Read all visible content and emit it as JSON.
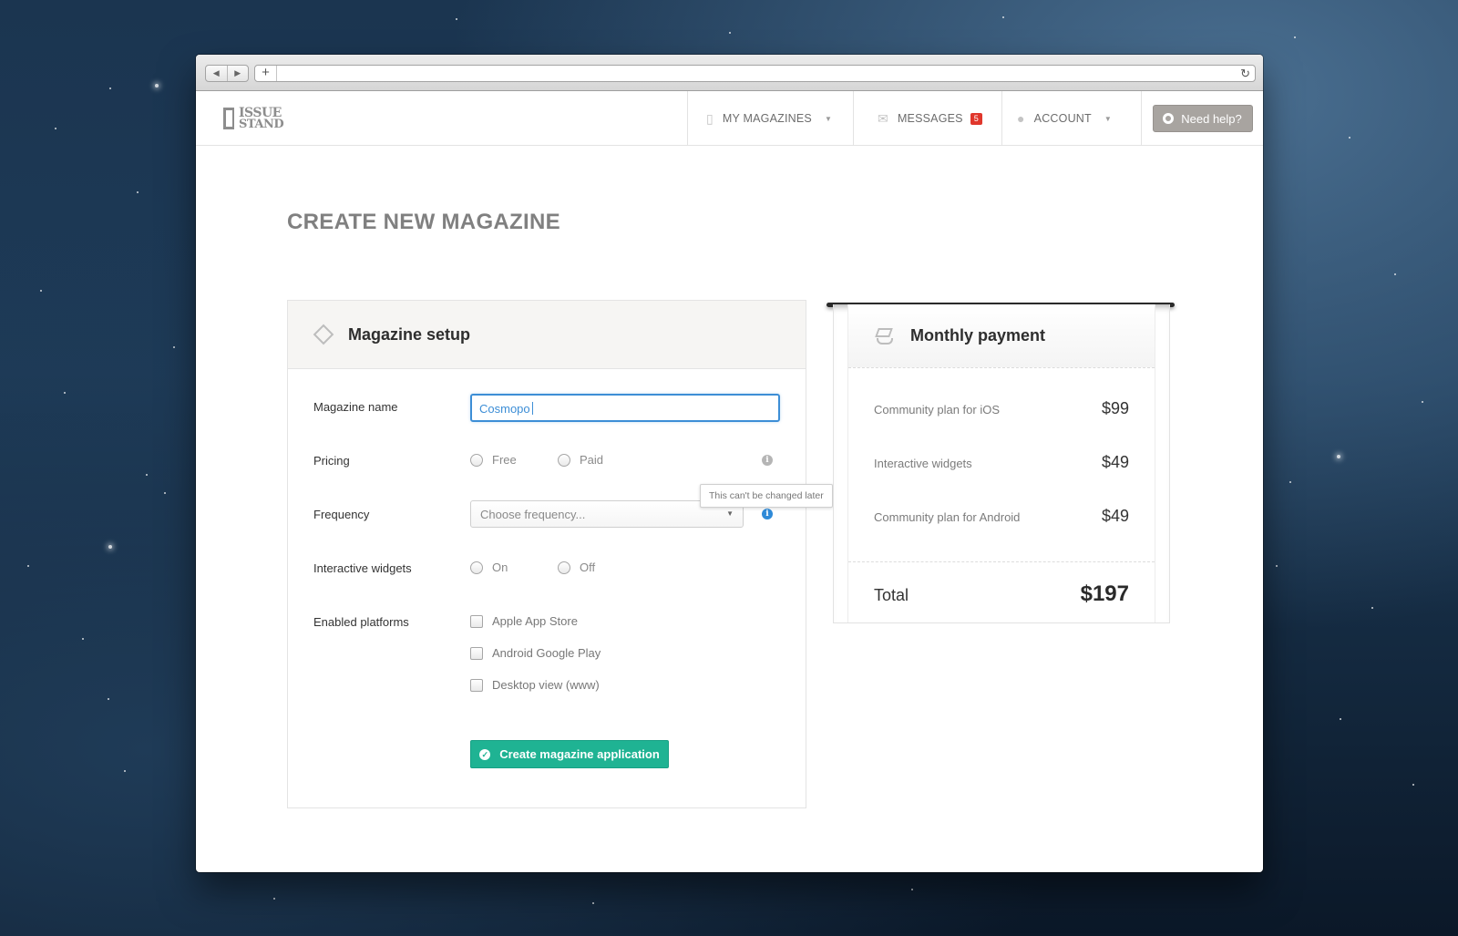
{
  "browser": {
    "back_glyph": "◀",
    "forward_glyph": "▶",
    "new_tab_glyph": "+",
    "reload_glyph": "↻"
  },
  "brand": {
    "line1": "ISSUE",
    "line2": "STAND"
  },
  "nav": {
    "my_magazines": "MY MAGAZINES",
    "messages": "MESSAGES",
    "messages_count": "5",
    "account": "ACCOUNT",
    "help": "Need help?"
  },
  "page_title": "CREATE NEW MAGAZINE",
  "setup": {
    "title": "Magazine setup",
    "magazine_name_label": "Magazine name",
    "magazine_name_value": "Cosmopo",
    "pricing_label": "Pricing",
    "pricing_options": [
      "Free",
      "Paid"
    ],
    "frequency_label": "Frequency",
    "frequency_placeholder": "Choose frequency...",
    "frequency_tooltip": "This can't be changed later",
    "widgets_label": "Interactive widgets",
    "widgets_options": [
      "On",
      "Off"
    ],
    "platforms_label": "Enabled platforms",
    "platforms": [
      "Apple App Store",
      "Android Google Play",
      "Desktop view (www)"
    ],
    "submit_label": "Create magazine application",
    "info_glyph": "i",
    "check_glyph": "✓"
  },
  "payment": {
    "title": "Monthly payment",
    "items": [
      {
        "label": "Community plan for iOS",
        "amount": "$99"
      },
      {
        "label": "Interactive widgets",
        "amount": "$49"
      },
      {
        "label": "Community plan for Android",
        "amount": "$49"
      }
    ],
    "total_label": "Total",
    "total_amount": "$197"
  },
  "colors": {
    "accent_blue": "#3d8ed6",
    "create_button": "#1fb393",
    "badge_red": "#e0372c",
    "help_button": "#a8a4a0"
  },
  "icons": {
    "magazines": "document-stack-icon",
    "messages": "envelope-icon",
    "account": "user-icon",
    "help": "lifebuoy-icon",
    "setup": "tag-icon",
    "payment": "graduation-cap-icon"
  }
}
